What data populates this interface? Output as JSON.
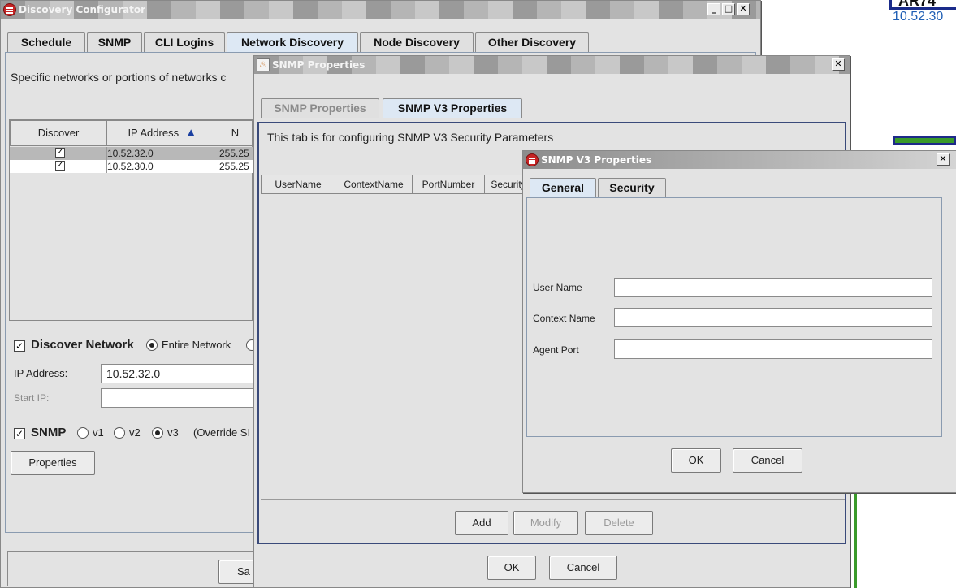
{
  "background_app": {
    "header_text": "AR74",
    "ip_text": "10.52.30"
  },
  "discovery_window": {
    "title": "Discovery Configurator",
    "tabs": [
      {
        "label": "Schedule"
      },
      {
        "label": "SNMP"
      },
      {
        "label": "CLI Logins"
      },
      {
        "label": "Network Discovery",
        "selected": true
      },
      {
        "label": "Node Discovery"
      },
      {
        "label": "Other Discovery"
      }
    ],
    "description": "Specific networks or portions of networks c",
    "table": {
      "columns": [
        "Discover",
        "IP Address",
        "N"
      ],
      "sort_indicator": "▲",
      "rows": [
        {
          "checked": true,
          "ip": "10.52.32.0",
          "mask": "255.25"
        },
        {
          "checked": true,
          "ip": "10.52.30.0",
          "mask": "255.25"
        }
      ]
    },
    "discover_network_label": "Discover Network",
    "entire_network_label": "Entire Network",
    "ip_address_label": "IP Address:",
    "ip_address_value": "10.52.32.0",
    "start_ip_label": "Start IP:",
    "start_ip_value": "",
    "snmp_label": "SNMP",
    "snmp_versions": [
      "v1",
      "v2",
      "v3"
    ],
    "snmp_selected": "v3",
    "override_label": "(Override SI",
    "properties_button": "Properties",
    "save_button_partial": "Sa"
  },
  "snmp_props_window": {
    "title": "SNMP Properties",
    "tabs": [
      {
        "label": "SNMP Properties"
      },
      {
        "label": "SNMP V3 Properties",
        "selected": true
      }
    ],
    "description": "This tab is for configuring SNMP V3 Security Parameters",
    "columns": [
      "UserName",
      "ContextName",
      "PortNumber",
      "Security"
    ],
    "buttons": {
      "add": "Add",
      "modify": "Modify",
      "delete": "Delete",
      "ok": "OK",
      "cancel": "Cancel"
    }
  },
  "v3_dialog": {
    "title": "SNMP V3 Properties",
    "tabs": [
      {
        "label": "General",
        "selected": true
      },
      {
        "label": "Security"
      }
    ],
    "fields": [
      {
        "label": "User Name",
        "value": ""
      },
      {
        "label": "Context Name",
        "value": ""
      },
      {
        "label": "Agent Port",
        "value": ""
      }
    ],
    "buttons": {
      "ok": "OK",
      "cancel": "Cancel"
    }
  },
  "colors": {
    "tab_selected": "#dde8f4",
    "panel_border": "#8a9bb0",
    "window_bg": "#e3e3e3",
    "link_blue": "#1f5fb5"
  }
}
